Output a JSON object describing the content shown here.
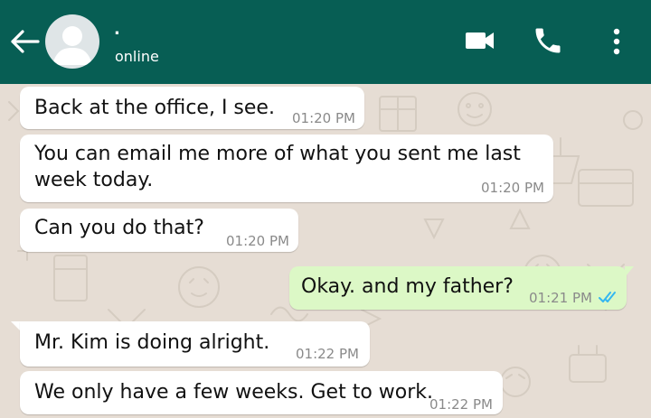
{
  "contact": {
    "name": ".",
    "status": "online"
  },
  "icons": {
    "back": "arrow-left-icon",
    "avatar": "default-avatar-icon",
    "video": "video-camera-icon",
    "call": "phone-icon",
    "menu": "more-vert-icon",
    "read_receipt": "double-check-icon"
  },
  "colors": {
    "header": "#075e54",
    "outgoing_bubble": "#dcf8c6",
    "incoming_bubble": "#ffffff",
    "read_ticks": "#34b7f1",
    "chat_background": "#e6ddd4"
  },
  "messages": [
    {
      "direction": "in",
      "lines": [
        "Back at the office, I see."
      ],
      "time": "01:20 PM"
    },
    {
      "direction": "in",
      "lines": [
        "You can email me more of what you sent me last",
        "week today."
      ],
      "time": "01:20 PM"
    },
    {
      "direction": "in",
      "lines": [
        "Can you do that?"
      ],
      "time": "01:20 PM"
    },
    {
      "direction": "out",
      "lines": [
        "Okay. and my father?"
      ],
      "time": "01:21 PM",
      "status": "read"
    },
    {
      "direction": "in",
      "lines": [
        "Mr. Kim is doing alright."
      ],
      "time": "01:22 PM"
    },
    {
      "direction": "in",
      "lines": [
        "We only have a few weeks. Get to work."
      ],
      "time": "01:22 PM"
    }
  ]
}
